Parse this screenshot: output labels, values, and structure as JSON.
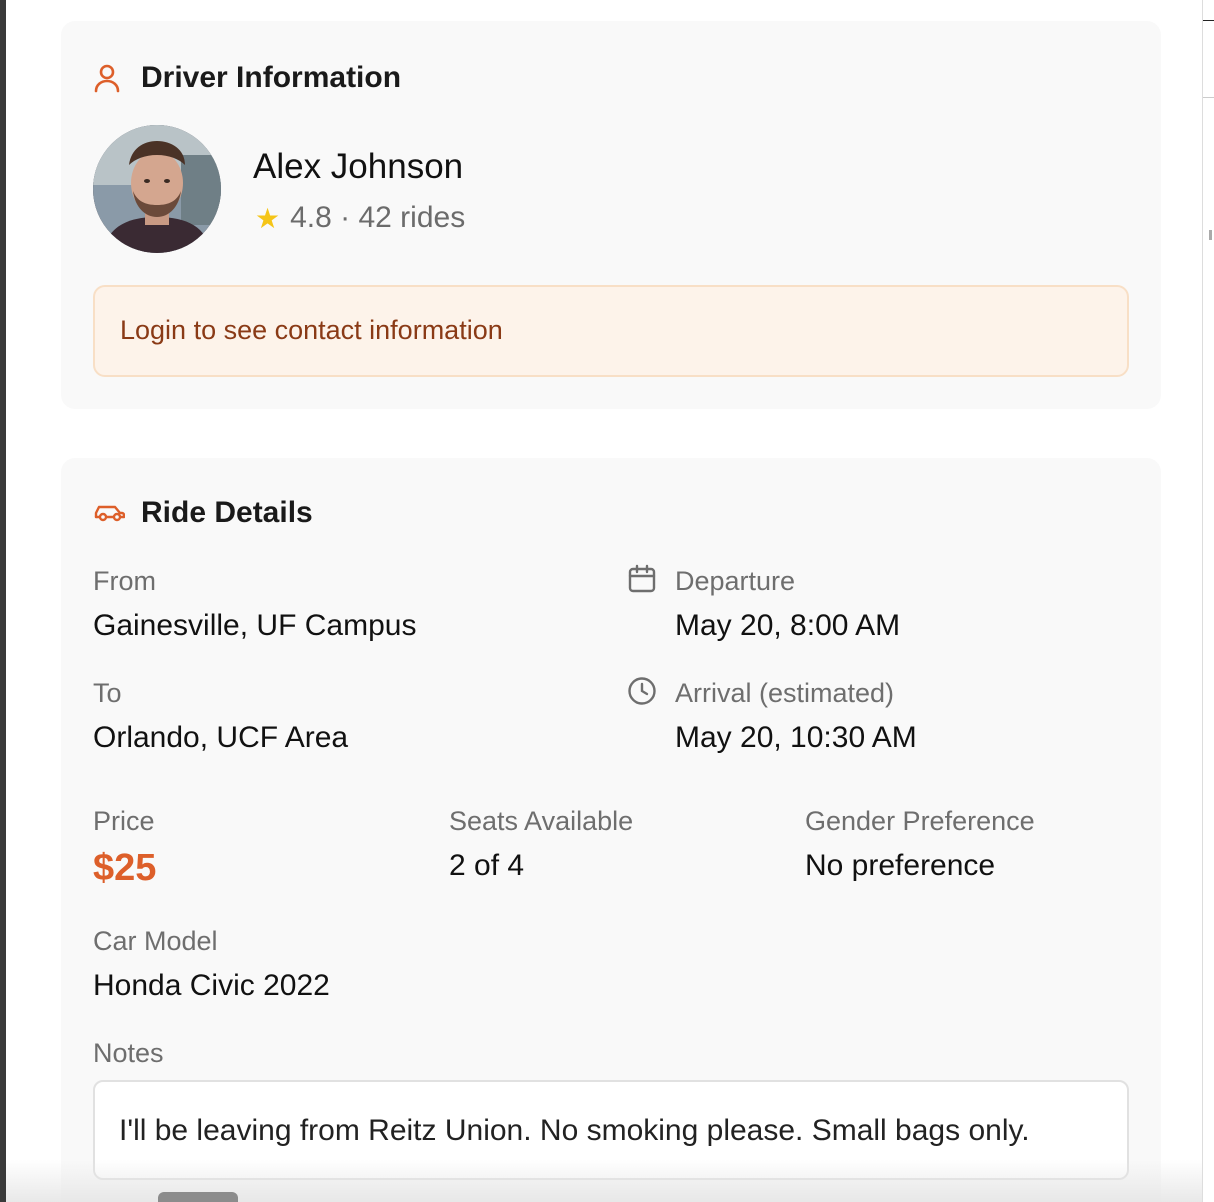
{
  "driver_card": {
    "title": "Driver Information",
    "icon": "user-icon",
    "name": "Alex Johnson",
    "rating_star": "★",
    "rating_text": "4.8 · 42 rides",
    "login_notice": "Login to see contact information"
  },
  "ride_card": {
    "title": "Ride Details",
    "icon": "car-icon",
    "from": {
      "label": "From",
      "value": "Gainesville, UF Campus"
    },
    "to": {
      "label": "To",
      "value": "Orlando, UCF Area"
    },
    "departure": {
      "label": "Departure",
      "value": "May 20, 8:00 AM",
      "icon": "calendar-icon"
    },
    "arrival": {
      "label": "Arrival (estimated)",
      "value": "May 20, 10:30 AM",
      "icon": "clock-icon"
    },
    "price": {
      "label": "Price",
      "value": "$25"
    },
    "seats": {
      "label": "Seats Available",
      "value": "2 of 4"
    },
    "gender": {
      "label": "Gender Preference",
      "value": "No preference"
    },
    "car": {
      "label": "Car Model",
      "value": "Honda Civic 2022"
    },
    "notes": {
      "label": "Notes",
      "value": "I'll be leaving from Reitz Union. No smoking please. Small bags only."
    }
  },
  "colors": {
    "accent": "#dd5f2a",
    "notice_bg": "#fdf3ea",
    "notice_text": "#8a3a16",
    "star": "#f5c518"
  }
}
